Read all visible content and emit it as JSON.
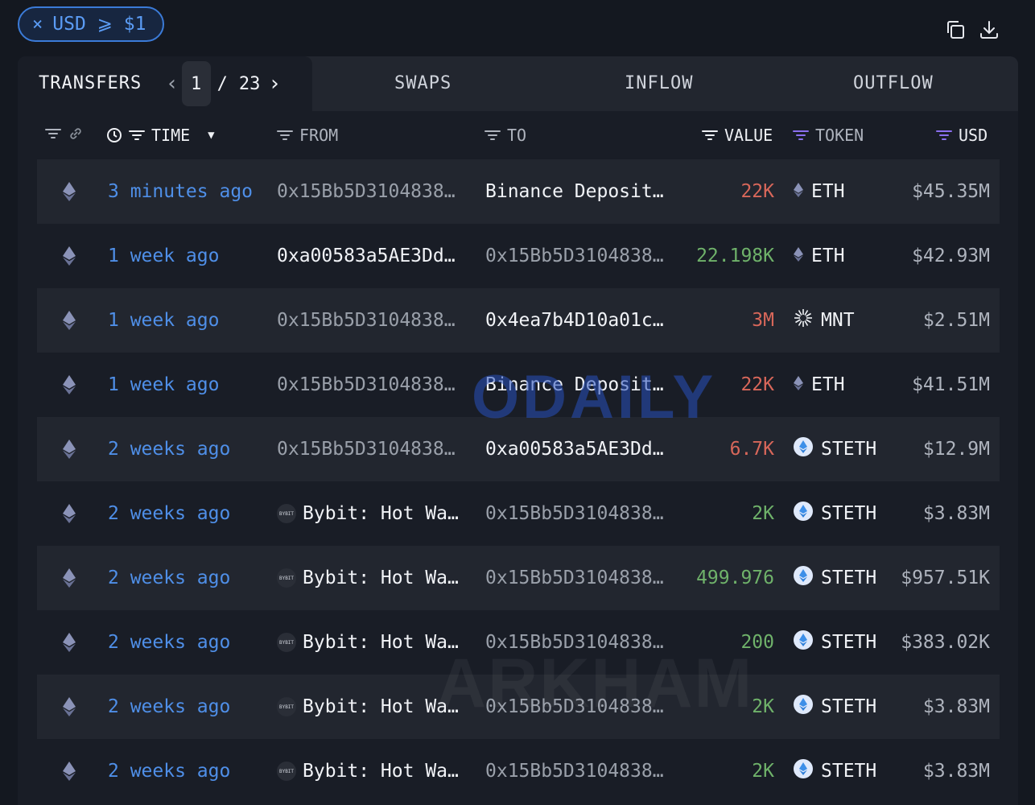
{
  "filter_chip": {
    "close": "×",
    "label": "USD ⩾ $1"
  },
  "toolbar": {
    "icons": [
      "copy-icon",
      "download-icon"
    ]
  },
  "tabs": {
    "transfers": "TRANSFERS",
    "page_current": "1",
    "page_sep": "/",
    "page_total": "23",
    "swaps": "SWAPS",
    "inflow": "INFLOW",
    "outflow": "OUTFLOW"
  },
  "columns": {
    "time": "TIME",
    "from": "FROM",
    "to": "TO",
    "value": "VALUE",
    "token": "TOKEN",
    "usd": "USD"
  },
  "rows": [
    {
      "time": "3 minutes ago",
      "from": "0x15Bb5D3104838…",
      "to": "Binance Deposit…",
      "value": "22K",
      "token": "ETH",
      "usd": "$45.35M"
    },
    {
      "time": "1 week ago",
      "from": "0xa00583a5AE3Dd…",
      "to": "0x15Bb5D3104838…",
      "value": "22.198K",
      "token": "ETH",
      "usd": "$42.93M"
    },
    {
      "time": "1 week ago",
      "from": "0x15Bb5D3104838…",
      "to": "0x4ea7b4D10a01c…",
      "value": "3M",
      "token": "MNT",
      "usd": "$2.51M"
    },
    {
      "time": "1 week ago",
      "from": "0x15Bb5D3104838…",
      "to": "Binance Deposit…",
      "value": "22K",
      "token": "ETH",
      "usd": "$41.51M"
    },
    {
      "time": "2 weeks ago",
      "from": "0x15Bb5D3104838…",
      "to": "0xa00583a5AE3Dd…",
      "value": "6.7K",
      "token": "STETH",
      "usd": "$12.9M"
    },
    {
      "time": "2 weeks ago",
      "from": "Bybit: Hot Wa…",
      "to": "0x15Bb5D3104838…",
      "value": "2K",
      "token": "STETH",
      "usd": "$3.83M"
    },
    {
      "time": "2 weeks ago",
      "from": "Bybit: Hot Wa…",
      "to": "0x15Bb5D3104838…",
      "value": "499.976",
      "token": "STETH",
      "usd": "$957.51K"
    },
    {
      "time": "2 weeks ago",
      "from": "Bybit: Hot Wa…",
      "to": "0x15Bb5D3104838…",
      "value": "200",
      "token": "STETH",
      "usd": "$383.02K"
    },
    {
      "time": "2 weeks ago",
      "from": "Bybit: Hot Wa…",
      "to": "0x15Bb5D3104838…",
      "value": "2K",
      "token": "STETH",
      "usd": "$3.83M"
    },
    {
      "time": "2 weeks ago",
      "from": "Bybit: Hot Wa…",
      "to": "0x15Bb5D3104838…",
      "value": "2K",
      "token": "STETH",
      "usd": "$3.83M"
    }
  ],
  "bybit_logo_text": "BYBIT",
  "colors": {
    "accent": "#4f8fe8",
    "negative": "#d8675a",
    "positive": "#6fb26a"
  },
  "watermarks": {
    "odaily": "ODAILY",
    "arkham": "ARKHAM"
  }
}
